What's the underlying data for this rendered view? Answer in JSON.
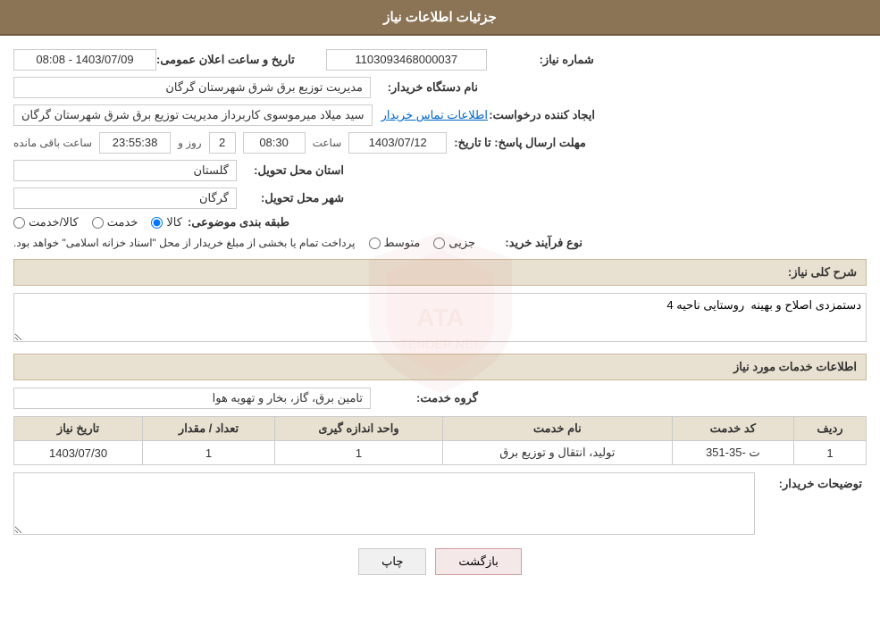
{
  "header": {
    "title": "جزئیات اطلاعات نیاز"
  },
  "fields": {
    "need_number_label": "شماره نیاز:",
    "need_number_value": "1103093468000037",
    "announce_date_label": "تاریخ و ساعت اعلان عمومی:",
    "announce_date_value": "1403/07/09 - 08:08",
    "buyer_org_label": "نام دستگاه خریدار:",
    "buyer_org_value": "مدیریت توزیع برق شرق شهرستان گرگان",
    "creator_label": "ایجاد کننده درخواست:",
    "creator_value": "سید میلاد میرموسوی کاربرداز مدیریت توزیع برق شرق شهرستان گرگان",
    "contact_link": "اطلاعات تماس خریدار",
    "deadline_label": "مهلت ارسال پاسخ: تا تاریخ:",
    "deadline_date": "1403/07/12",
    "deadline_time_label": "ساعت",
    "deadline_time": "08:30",
    "deadline_days_label": "روز و",
    "deadline_days": "2",
    "deadline_remaining_label": "ساعت باقی مانده",
    "deadline_remaining": "23:55:38",
    "province_label": "استان محل تحویل:",
    "province_value": "گلستان",
    "city_label": "شهر محل تحویل:",
    "city_value": "گرگان",
    "category_label": "طبقه بندی موضوعی:",
    "category_options": [
      {
        "label": "کالا",
        "selected": true
      },
      {
        "label": "خدمت",
        "selected": false
      },
      {
        "label": "کالا/خدمت",
        "selected": false
      }
    ],
    "purchase_type_label": "نوع فرآیند خرید:",
    "purchase_options": [
      {
        "label": "جزیی",
        "selected": false
      },
      {
        "label": "متوسط",
        "selected": false
      }
    ],
    "purchase_note": "پرداخت تمام یا بخشی از مبلغ خریدار از محل \"اسناد خزانه اسلامی\" خواهد بود.",
    "general_description_label": "شرح کلی نیاز:",
    "general_description_value": "دستمزدی اصلاح و بهینه  روستایی ناحیه 4",
    "services_section_title": "اطلاعات خدمات مورد نیاز",
    "service_group_label": "گروه خدمت:",
    "service_group_value": "تامین برق، گاز، بخار و تهویه هوا",
    "table": {
      "columns": [
        "ردیف",
        "کد خدمت",
        "نام خدمت",
        "واحد اندازه گیری",
        "تعداد / مقدار",
        "تاریخ نیاز"
      ],
      "rows": [
        {
          "row_num": "1",
          "code": "ت -35-351",
          "name": "تولید، انتقال و توزیع برق",
          "unit": "1",
          "quantity": "1",
          "date": "1403/07/30"
        }
      ]
    },
    "buyer_notes_label": "توضیحات خریدار:",
    "buyer_notes_value": ""
  },
  "buttons": {
    "print_label": "چاپ",
    "back_label": "بازگشت"
  }
}
